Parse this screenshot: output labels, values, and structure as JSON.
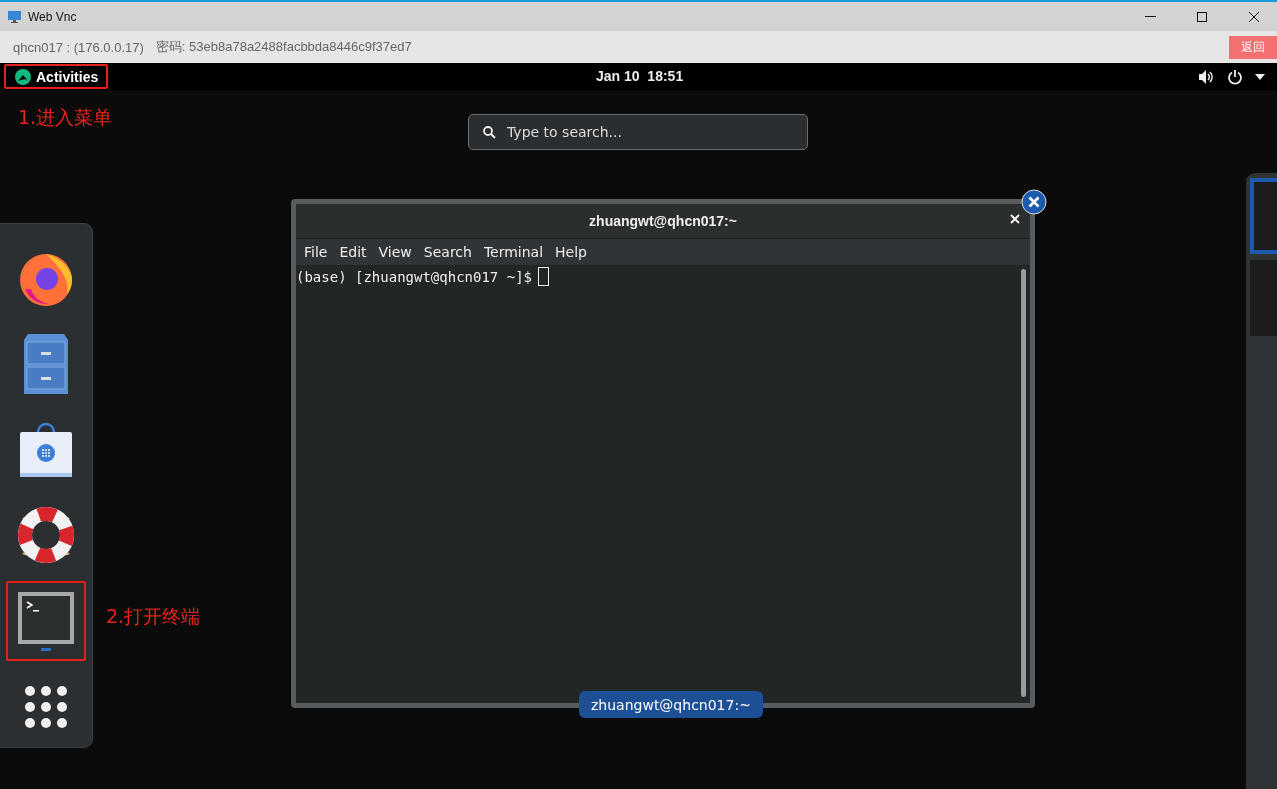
{
  "app_window": {
    "title": "Web Vnc",
    "host": "qhcn017 : (176.0.0.17)",
    "password": "密码: 53eb8a78a2488facbbda8446c9f37ed7",
    "back_button": "返回"
  },
  "top_bar": {
    "activities": "Activities",
    "clock": "Jan 10  18:51"
  },
  "search": {
    "placeholder": "Type to search..."
  },
  "dash": {
    "apps": [
      {
        "kind": "firefox",
        "running": false
      },
      {
        "kind": "files",
        "running": false
      },
      {
        "kind": "software",
        "running": false
      },
      {
        "kind": "help",
        "running": false
      },
      {
        "kind": "terminal",
        "running": true
      },
      {
        "kind": "grid",
        "running": false
      }
    ]
  },
  "terminal": {
    "title": "zhuangwt@qhcn017:~",
    "menu": [
      "File",
      "Edit",
      "View",
      "Search",
      "Terminal",
      "Help"
    ],
    "prompt": "(base) [zhuangwt@qhcn017 ~]$",
    "caption": "zhuangwt@qhcn017:~"
  },
  "workspaces": [
    {
      "selected": true
    },
    {
      "selected": false
    }
  ],
  "annotations": [
    "1.进入菜单",
    "2.打开终端"
  ]
}
